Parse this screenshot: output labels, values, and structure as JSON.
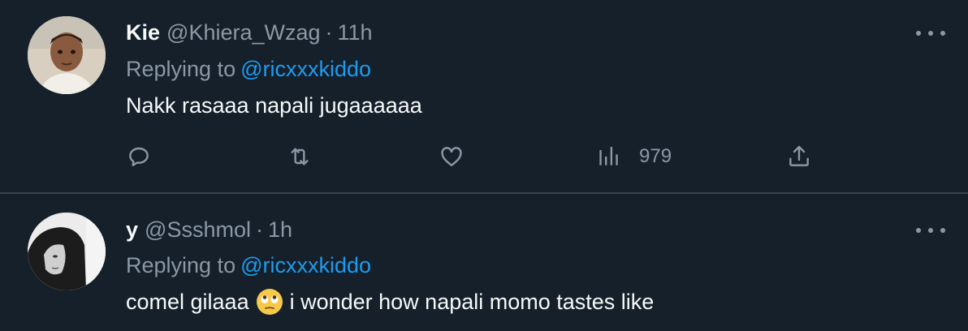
{
  "tweets": [
    {
      "name": "Kie",
      "handle": "@Khiera_Wzag",
      "separator": "·",
      "time": "11h",
      "reply_prefix": "Replying to",
      "reply_to": "@ricxxxkiddo",
      "text": "Nakk rasaaa napali jugaaaaaa",
      "actions": {
        "reply_icon": "reply-icon",
        "retweet_icon": "retweet-icon",
        "like_icon": "heart-icon",
        "views_icon": "analytics-icon",
        "views_count": "979",
        "share_icon": "share-icon"
      }
    },
    {
      "name": "y",
      "handle": "@Ssshmol",
      "separator": "·",
      "time": "1h",
      "reply_prefix": "Replying to",
      "reply_to": "@ricxxxkiddo",
      "text_before_emoji": "comel gilaaa",
      "emoji": "face-with-rolling-eyes-emoji",
      "text_after_emoji": "i wonder how napali momo tastes like"
    }
  ],
  "colors": {
    "background": "#15202b",
    "primary_text": "#f7f9f9",
    "secondary_text": "#8b98a5",
    "link": "#1d9bf0",
    "divider": "#38444d"
  }
}
